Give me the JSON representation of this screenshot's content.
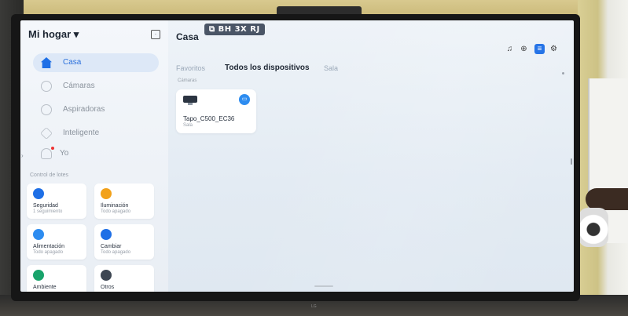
{
  "sidebar": {
    "home_title": "Mi hogar ▾",
    "nav": [
      {
        "label": "Casa",
        "icon": "house-icon"
      },
      {
        "label": "Cámaras",
        "icon": "camera-icon"
      },
      {
        "label": "Aspiradoras",
        "icon": "vacuum-icon"
      },
      {
        "label": "Inteligente",
        "icon": "smart-cube-icon"
      },
      {
        "label": "Yo",
        "icon": "person-icon"
      }
    ],
    "section_title": "Control de lotes",
    "cards": [
      {
        "title": "Seguridad",
        "sub": "1 seguimiento",
        "color": "#1e6fe6"
      },
      {
        "title": "Iluminación",
        "sub": "Todo apagado",
        "color": "#f2a11a"
      },
      {
        "title": "Alimentación",
        "sub": "Todo apagado",
        "color": "#2d8cf0"
      },
      {
        "title": "Cambiar",
        "sub": "Todo apagado",
        "color": "#1e6fe6"
      },
      {
        "title": "Ambiente",
        "sub": "",
        "color": "#18a36b"
      },
      {
        "title": "Otros",
        "sub": "",
        "color": "#3d4652"
      }
    ]
  },
  "main": {
    "title": "Casa",
    "plate_text": "BH 3X RJ",
    "tabs": [
      {
        "label": "Favoritos"
      },
      {
        "label": "Todos los dispositivos"
      },
      {
        "label": "Sala"
      }
    ],
    "category_label": "Cámaras",
    "device": {
      "name": "Tapo_C500_EC36",
      "room": "Sala"
    }
  },
  "tv": {
    "brand": "LG"
  }
}
